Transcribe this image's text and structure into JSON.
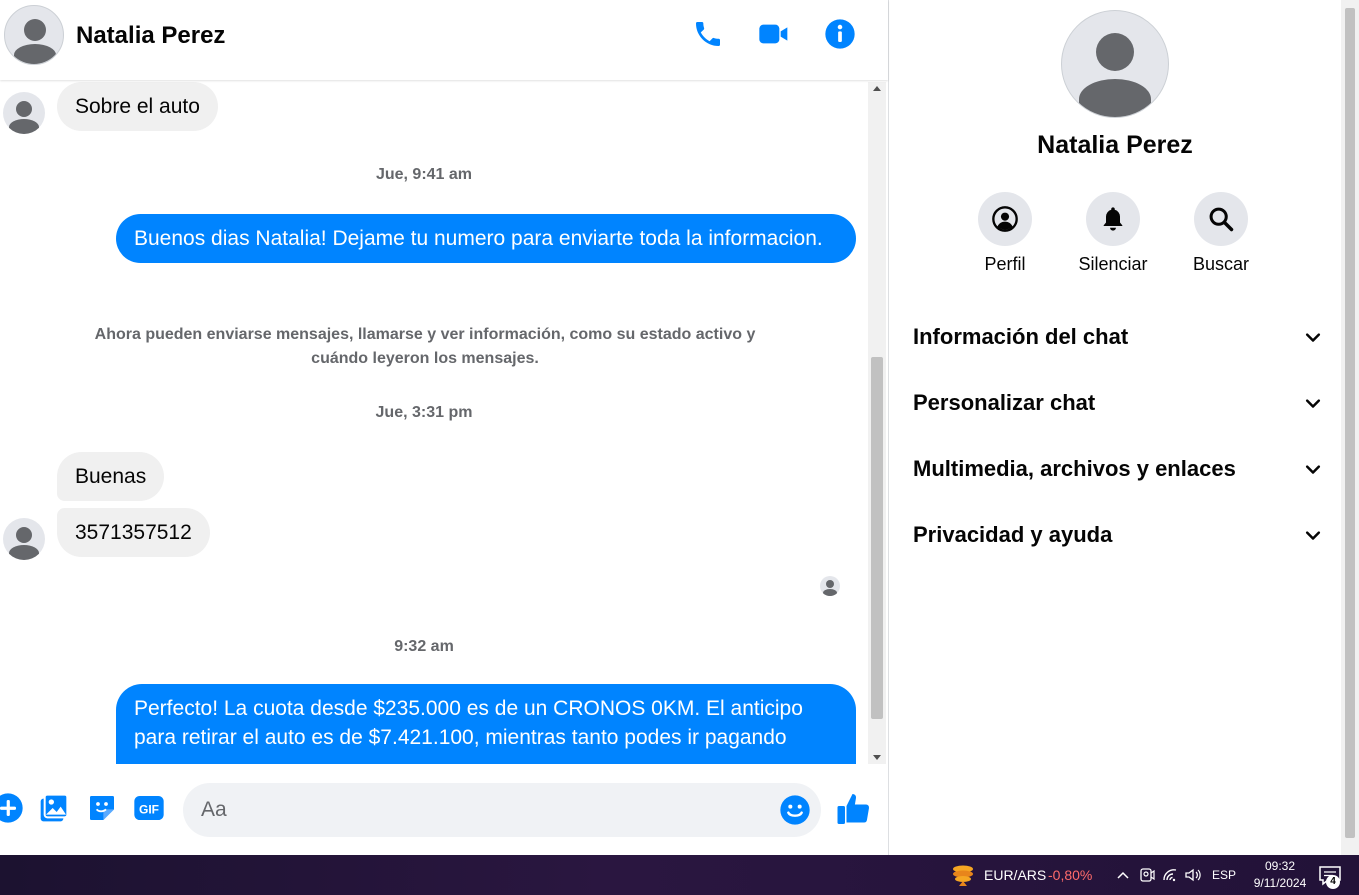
{
  "contact": {
    "name": "Natalia Perez"
  },
  "header": {
    "icons": [
      "phone-icon",
      "video-camera-icon",
      "info-icon"
    ]
  },
  "messages": {
    "m1": "Sobre el auto",
    "t1": "Jue, 9:41 am",
    "m2": "Buenos dias Natalia! Dejame tu numero para enviarte toda la informacion.",
    "system_note": "Ahora pueden enviarse mensajes, llamarse y ver información, como su estado activo y cuándo leyeron los mensajes.",
    "t2": "Jue, 3:31 pm",
    "m3": "Buenas",
    "m4": "3571357512",
    "t3": "9:32 am",
    "m5": "Perfecto! La cuota desde $235.000 es de un CRONOS 0KM. El anticipo para retirar el auto es de $7.421.100, mientras tanto podes ir pagando"
  },
  "composer": {
    "placeholder": "Aa",
    "icons": [
      "plus-icon",
      "image-icon",
      "sticker-icon",
      "gif-icon",
      "emoji-icon",
      "thumbs-up-icon"
    ],
    "gif_label": "GIF"
  },
  "panel": {
    "actions": [
      {
        "label": "Perfil",
        "icon": "profile-icon"
      },
      {
        "label": "Silenciar",
        "icon": "bell-icon"
      },
      {
        "label": "Buscar",
        "icon": "search-icon"
      }
    ],
    "sections": [
      "Información del chat",
      "Personalizar chat",
      "Multimedia, archivos y enlaces",
      "Privacidad y ayuda"
    ]
  },
  "taskbar": {
    "ticker_pair": "EUR/ARS",
    "ticker_change": "-0,80%",
    "language": "ESP",
    "time": "09:32",
    "date": "9/11/2024",
    "notification_count": "4"
  },
  "colors": {
    "accent": "#0084ff",
    "incoming_bubble": "#f0f0f0",
    "ticker_negative": "#ff6b6b"
  }
}
